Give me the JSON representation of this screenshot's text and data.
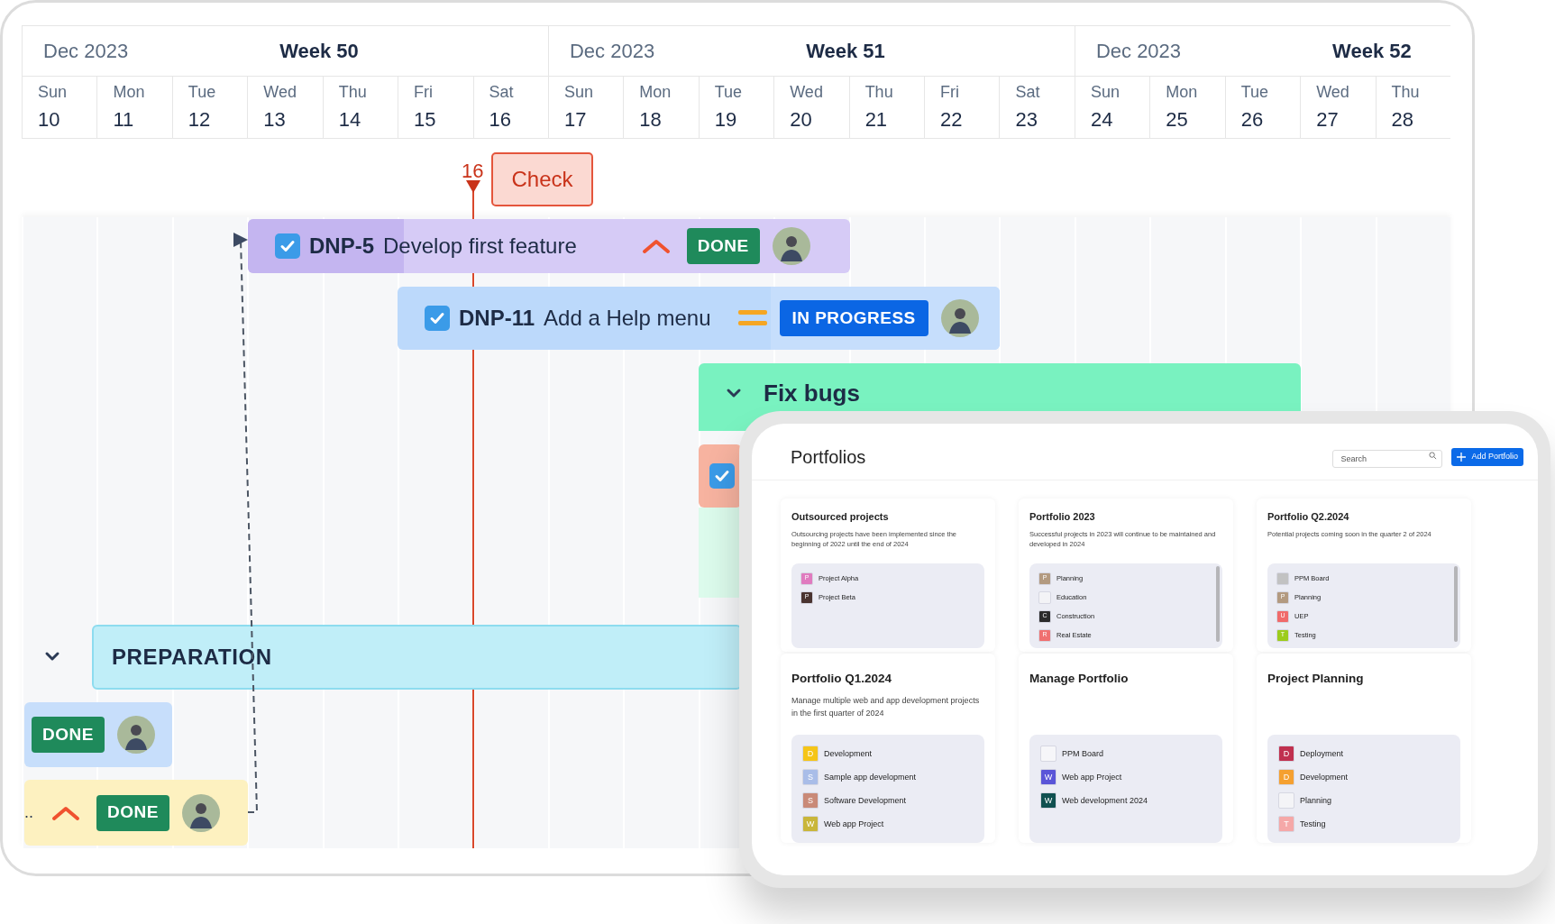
{
  "timeline": {
    "weeks": [
      {
        "month": "Dec 2023",
        "week": "Week 50"
      },
      {
        "month": "Dec 2023",
        "week": "Week 51"
      },
      {
        "month": "Dec 2023",
        "week": "Week 52"
      }
    ],
    "days": [
      {
        "weekday": "Sun",
        "date": "10"
      },
      {
        "weekday": "Mon",
        "date": "11"
      },
      {
        "weekday": "Tue",
        "date": "12"
      },
      {
        "weekday": "Wed",
        "date": "13"
      },
      {
        "weekday": "Thu",
        "date": "14"
      },
      {
        "weekday": "Fri",
        "date": "15"
      },
      {
        "weekday": "Sat",
        "date": "16"
      },
      {
        "weekday": "Sun",
        "date": "17"
      },
      {
        "weekday": "Mon",
        "date": "18"
      },
      {
        "weekday": "Tue",
        "date": "19"
      },
      {
        "weekday": "Wed",
        "date": "20"
      },
      {
        "weekday": "Thu",
        "date": "21"
      },
      {
        "weekday": "Fri",
        "date": "22"
      },
      {
        "weekday": "Sat",
        "date": "23"
      },
      {
        "weekday": "Sun",
        "date": "24"
      },
      {
        "weekday": "Mon",
        "date": "25"
      },
      {
        "weekday": "Tue",
        "date": "26"
      },
      {
        "weekday": "Wed",
        "date": "27"
      },
      {
        "weekday": "Thu",
        "date": "28"
      }
    ],
    "today": "16",
    "milestone": "Check"
  },
  "bars": [
    {
      "kind": "task",
      "key": "DNP-5",
      "title": "Develop first feature",
      "checked": true,
      "priority": {
        "kind": "high"
      },
      "status": {
        "label": "DONE",
        "kind": "done"
      }
    },
    {
      "kind": "task",
      "key": "DNP-11",
      "title": "Add a Help menu",
      "checked": true,
      "priority": {
        "kind": "medium"
      },
      "status": {
        "label": "IN PROGRESS",
        "kind": "in_progress"
      }
    },
    {
      "kind": "group",
      "title": "Fix bugs",
      "expanded": true
    },
    {
      "kind": "task",
      "checked": true
    },
    {
      "kind": "group",
      "title": "PREPARATION",
      "expanded": true
    },
    {
      "kind": "task",
      "status": {
        "label": "DONE",
        "kind": "done"
      }
    },
    {
      "kind": "task",
      "prefix": "..",
      "priority": {
        "kind": "high"
      },
      "status": {
        "label": "DONE",
        "kind": "done"
      }
    }
  ],
  "portfolios": {
    "title": "Portfolios",
    "search": {
      "placeholder": "Search"
    },
    "add_button": "Add Portfolio",
    "cards": [
      {
        "title": "Outsourced projects",
        "description": "Outsourcing projects have been implemented since the beginning of 2022 until the end of 2024",
        "projects": [
          {
            "letter": "P",
            "name": "Project Alpha",
            "color": "#e07bbf"
          },
          {
            "letter": "P",
            "name": "Project Beta",
            "color": "#4a3430"
          }
        ]
      },
      {
        "title": "Portfolio 2023",
        "description": "Successful projects in 2023 will continue to be maintained and developed in 2024",
        "projects": [
          {
            "letter": "P",
            "name": "Planning",
            "color": "#b39a80"
          },
          {
            "name": "Education",
            "color": "#f3f3f6"
          },
          {
            "letter": "C",
            "name": "Construction",
            "color": "#2b2b2b"
          },
          {
            "letter": "R",
            "name": "Real Estate",
            "color": "#f07070"
          }
        ]
      },
      {
        "title": "Portfolio Q2.2024",
        "description": "Potential projects coming soon in the quarter 2 of 2024",
        "projects": [
          {
            "name": "PPM Board",
            "color": "#c2c2c2"
          },
          {
            "letter": "P",
            "name": "Planning",
            "color": "#b39a80"
          },
          {
            "letter": "U",
            "name": "UEP",
            "color": "#f06a6a"
          },
          {
            "letter": "T",
            "name": "Testing",
            "color": "#9ccc1c"
          }
        ]
      },
      {
        "title": "Portfolio Q1.2024",
        "description": "Manage multiple web and app development projects in the first quarter of 2024",
        "projects": [
          {
            "letter": "D",
            "name": "Development",
            "color": "#f5c518"
          },
          {
            "letter": "S",
            "name": "Sample app development",
            "color": "#a9bde8"
          },
          {
            "letter": "S",
            "name": "Software Development",
            "color": "#c98a78"
          },
          {
            "letter": "W",
            "name": "Web app Project",
            "color": "#c9b63a"
          }
        ]
      },
      {
        "title": "Manage Portfolio",
        "projects": [
          {
            "name": "PPM Board",
            "color": "#f6f6f9"
          },
          {
            "letter": "W",
            "name": "Web app Project",
            "color": "#5a55d8"
          },
          {
            "letter": "W",
            "name": "Web development 2024",
            "color": "#105050"
          }
        ]
      },
      {
        "title": "Project Planning",
        "projects": [
          {
            "letter": "D",
            "name": "Deployment",
            "color": "#c0304f"
          },
          {
            "letter": "D",
            "name": "Development",
            "color": "#f5a030"
          },
          {
            "name": "Planning",
            "color": "#f4f4f7"
          },
          {
            "letter": "T",
            "name": "Testing",
            "color": "#f5a8a8"
          }
        ]
      }
    ]
  }
}
